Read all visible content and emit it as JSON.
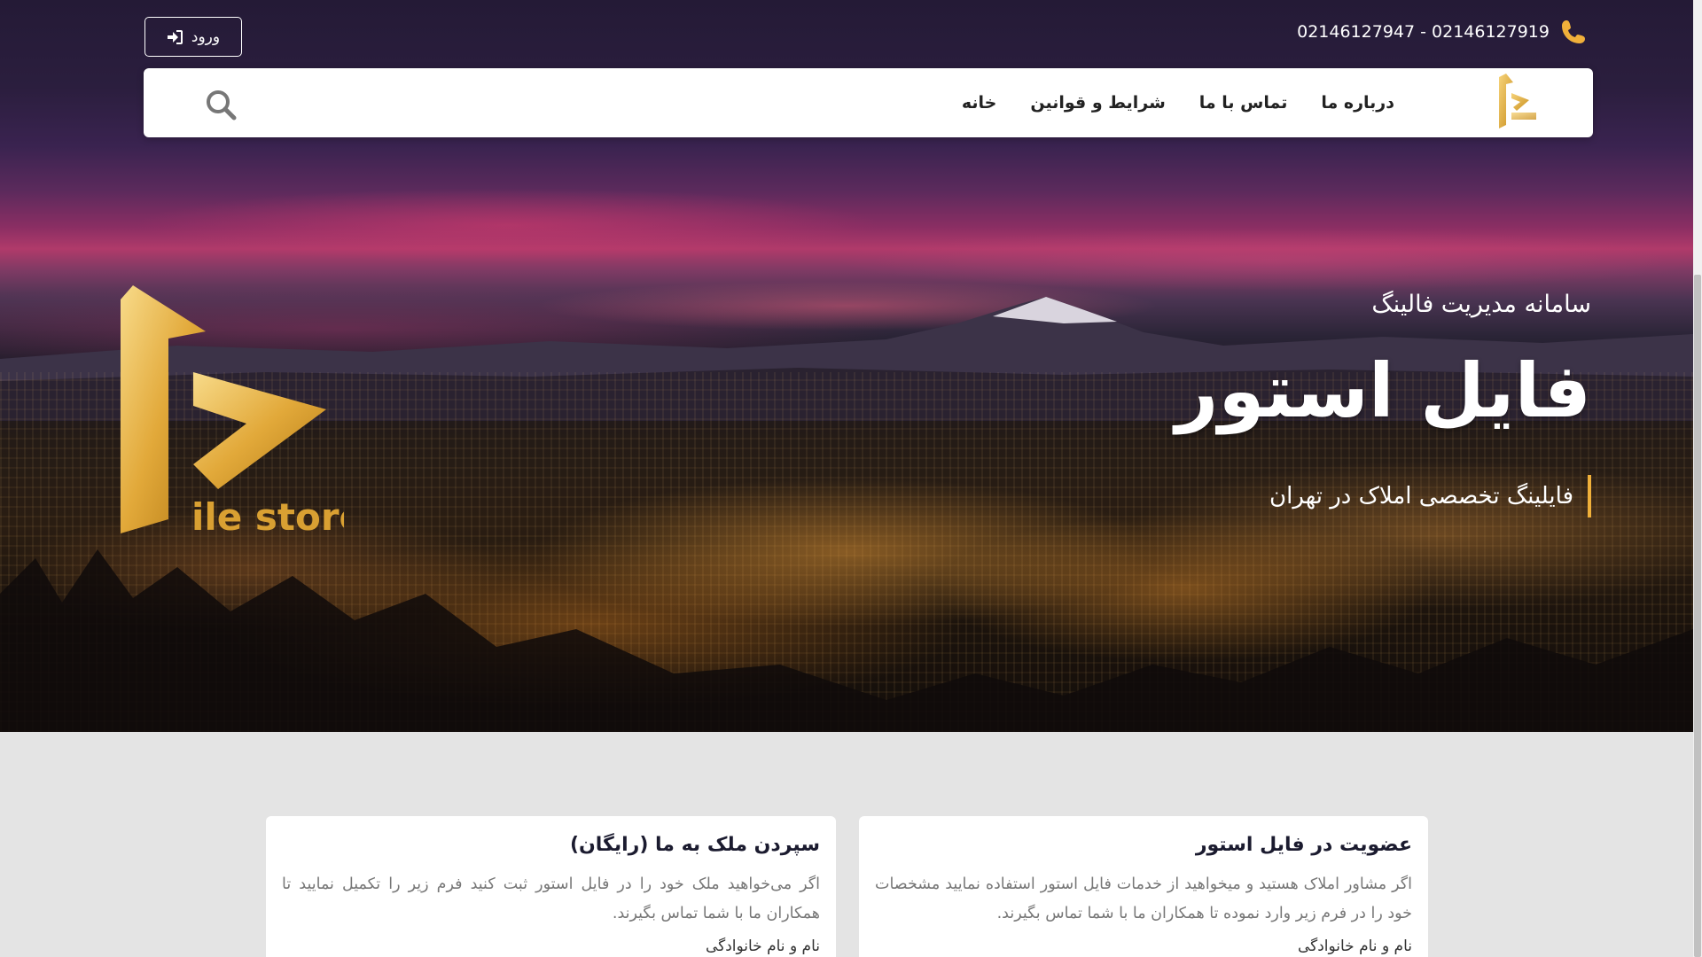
{
  "topbar": {
    "login_label": "ورود",
    "phones": "02146127947 - 02146127919"
  },
  "nav": {
    "links": [
      "خانه",
      "شرایط و قوانین",
      "تماس با ما",
      "درباره ما"
    ]
  },
  "hero": {
    "subtitle": "سامانه مدیریت فالینگ",
    "title": "فایل استور",
    "tagline": "فایلینگ تخصصی املاک در تهران",
    "logo_text": "ile store"
  },
  "cards": {
    "membership": {
      "title": "عضویت در فایل استور",
      "description": "اگر مشاور املاک هستید و میخواهید از خدمات فایل استور استفاده نمایید مشخصات خود را در فرم زیر وارد نموده تا همکاران ما با شما تماس بگیرند.",
      "field_label": "نام و نام خانوادگی"
    },
    "listing": {
      "title": "سپردن ملک به ما (رایگان)",
      "description": "اگر می‌خواهید ملک خود را در فایل استور ثبت کنید فرم زیر را تکمیل نمایید تا همکاران ما با شما تماس بگیرند.",
      "field_label": "نام و نام خانوادگی"
    }
  },
  "colors": {
    "accent_gold": "#f0b03a",
    "navbar_bg": "#ffffff",
    "page_bg": "#e4e4e4"
  },
  "icons": {
    "login": "sign-in-icon",
    "phone": "phone-icon",
    "search": "search-icon",
    "logo": "file-store-logo"
  }
}
